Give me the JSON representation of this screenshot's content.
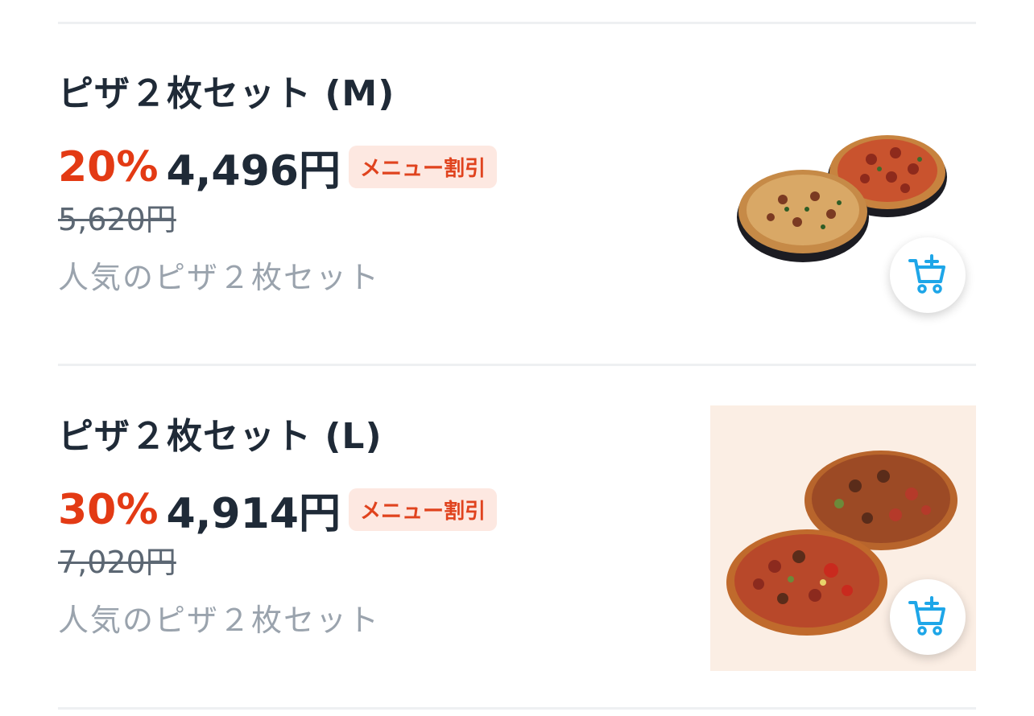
{
  "items": [
    {
      "title": "ピザ２枚セット (M)",
      "discount": "20%",
      "price": "4,496円",
      "badge": "メニュー割引",
      "old_price": "5,620円",
      "description": "人気のピザ２枚セット"
    },
    {
      "title": "ピザ２枚セット (L)",
      "discount": "30%",
      "price": "4,914円",
      "badge": "メニュー割引",
      "old_price": "7,020円",
      "description": "人気のピザ２枚セット"
    }
  ],
  "colors": {
    "discount": "#e33a14",
    "title": "#1f2a37",
    "badge_bg": "#fde8e1",
    "badge_text": "#e0431e",
    "muted": "#9aa3ad",
    "cart_icon": "#1ea6e8"
  },
  "icons": {
    "cart": "cart-plus-icon"
  }
}
